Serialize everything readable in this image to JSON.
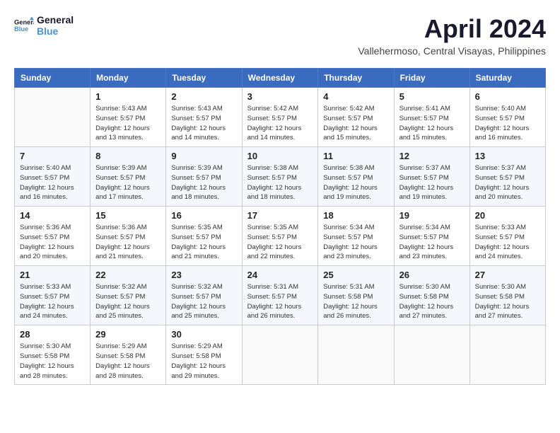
{
  "header": {
    "logo_line1": "General",
    "logo_line2": "Blue",
    "title": "April 2024",
    "subtitle": "Vallehermoso, Central Visayas, Philippines"
  },
  "calendar": {
    "days_of_week": [
      "Sunday",
      "Monday",
      "Tuesday",
      "Wednesday",
      "Thursday",
      "Friday",
      "Saturday"
    ],
    "weeks": [
      [
        {
          "day": "",
          "info": ""
        },
        {
          "day": "1",
          "info": "Sunrise: 5:43 AM\nSunset: 5:57 PM\nDaylight: 12 hours\nand 13 minutes."
        },
        {
          "day": "2",
          "info": "Sunrise: 5:43 AM\nSunset: 5:57 PM\nDaylight: 12 hours\nand 14 minutes."
        },
        {
          "day": "3",
          "info": "Sunrise: 5:42 AM\nSunset: 5:57 PM\nDaylight: 12 hours\nand 14 minutes."
        },
        {
          "day": "4",
          "info": "Sunrise: 5:42 AM\nSunset: 5:57 PM\nDaylight: 12 hours\nand 15 minutes."
        },
        {
          "day": "5",
          "info": "Sunrise: 5:41 AM\nSunset: 5:57 PM\nDaylight: 12 hours\nand 15 minutes."
        },
        {
          "day": "6",
          "info": "Sunrise: 5:40 AM\nSunset: 5:57 PM\nDaylight: 12 hours\nand 16 minutes."
        }
      ],
      [
        {
          "day": "7",
          "info": "Sunrise: 5:40 AM\nSunset: 5:57 PM\nDaylight: 12 hours\nand 16 minutes."
        },
        {
          "day": "8",
          "info": "Sunrise: 5:39 AM\nSunset: 5:57 PM\nDaylight: 12 hours\nand 17 minutes."
        },
        {
          "day": "9",
          "info": "Sunrise: 5:39 AM\nSunset: 5:57 PM\nDaylight: 12 hours\nand 18 minutes."
        },
        {
          "day": "10",
          "info": "Sunrise: 5:38 AM\nSunset: 5:57 PM\nDaylight: 12 hours\nand 18 minutes."
        },
        {
          "day": "11",
          "info": "Sunrise: 5:38 AM\nSunset: 5:57 PM\nDaylight: 12 hours\nand 19 minutes."
        },
        {
          "day": "12",
          "info": "Sunrise: 5:37 AM\nSunset: 5:57 PM\nDaylight: 12 hours\nand 19 minutes."
        },
        {
          "day": "13",
          "info": "Sunrise: 5:37 AM\nSunset: 5:57 PM\nDaylight: 12 hours\nand 20 minutes."
        }
      ],
      [
        {
          "day": "14",
          "info": "Sunrise: 5:36 AM\nSunset: 5:57 PM\nDaylight: 12 hours\nand 20 minutes."
        },
        {
          "day": "15",
          "info": "Sunrise: 5:36 AM\nSunset: 5:57 PM\nDaylight: 12 hours\nand 21 minutes."
        },
        {
          "day": "16",
          "info": "Sunrise: 5:35 AM\nSunset: 5:57 PM\nDaylight: 12 hours\nand 21 minutes."
        },
        {
          "day": "17",
          "info": "Sunrise: 5:35 AM\nSunset: 5:57 PM\nDaylight: 12 hours\nand 22 minutes."
        },
        {
          "day": "18",
          "info": "Sunrise: 5:34 AM\nSunset: 5:57 PM\nDaylight: 12 hours\nand 23 minutes."
        },
        {
          "day": "19",
          "info": "Sunrise: 5:34 AM\nSunset: 5:57 PM\nDaylight: 12 hours\nand 23 minutes."
        },
        {
          "day": "20",
          "info": "Sunrise: 5:33 AM\nSunset: 5:57 PM\nDaylight: 12 hours\nand 24 minutes."
        }
      ],
      [
        {
          "day": "21",
          "info": "Sunrise: 5:33 AM\nSunset: 5:57 PM\nDaylight: 12 hours\nand 24 minutes."
        },
        {
          "day": "22",
          "info": "Sunrise: 5:32 AM\nSunset: 5:57 PM\nDaylight: 12 hours\nand 25 minutes."
        },
        {
          "day": "23",
          "info": "Sunrise: 5:32 AM\nSunset: 5:57 PM\nDaylight: 12 hours\nand 25 minutes."
        },
        {
          "day": "24",
          "info": "Sunrise: 5:31 AM\nSunset: 5:57 PM\nDaylight: 12 hours\nand 26 minutes."
        },
        {
          "day": "25",
          "info": "Sunrise: 5:31 AM\nSunset: 5:58 PM\nDaylight: 12 hours\nand 26 minutes."
        },
        {
          "day": "26",
          "info": "Sunrise: 5:30 AM\nSunset: 5:58 PM\nDaylight: 12 hours\nand 27 minutes."
        },
        {
          "day": "27",
          "info": "Sunrise: 5:30 AM\nSunset: 5:58 PM\nDaylight: 12 hours\nand 27 minutes."
        }
      ],
      [
        {
          "day": "28",
          "info": "Sunrise: 5:30 AM\nSunset: 5:58 PM\nDaylight: 12 hours\nand 28 minutes."
        },
        {
          "day": "29",
          "info": "Sunrise: 5:29 AM\nSunset: 5:58 PM\nDaylight: 12 hours\nand 28 minutes."
        },
        {
          "day": "30",
          "info": "Sunrise: 5:29 AM\nSunset: 5:58 PM\nDaylight: 12 hours\nand 29 minutes."
        },
        {
          "day": "",
          "info": ""
        },
        {
          "day": "",
          "info": ""
        },
        {
          "day": "",
          "info": ""
        },
        {
          "day": "",
          "info": ""
        }
      ]
    ]
  }
}
